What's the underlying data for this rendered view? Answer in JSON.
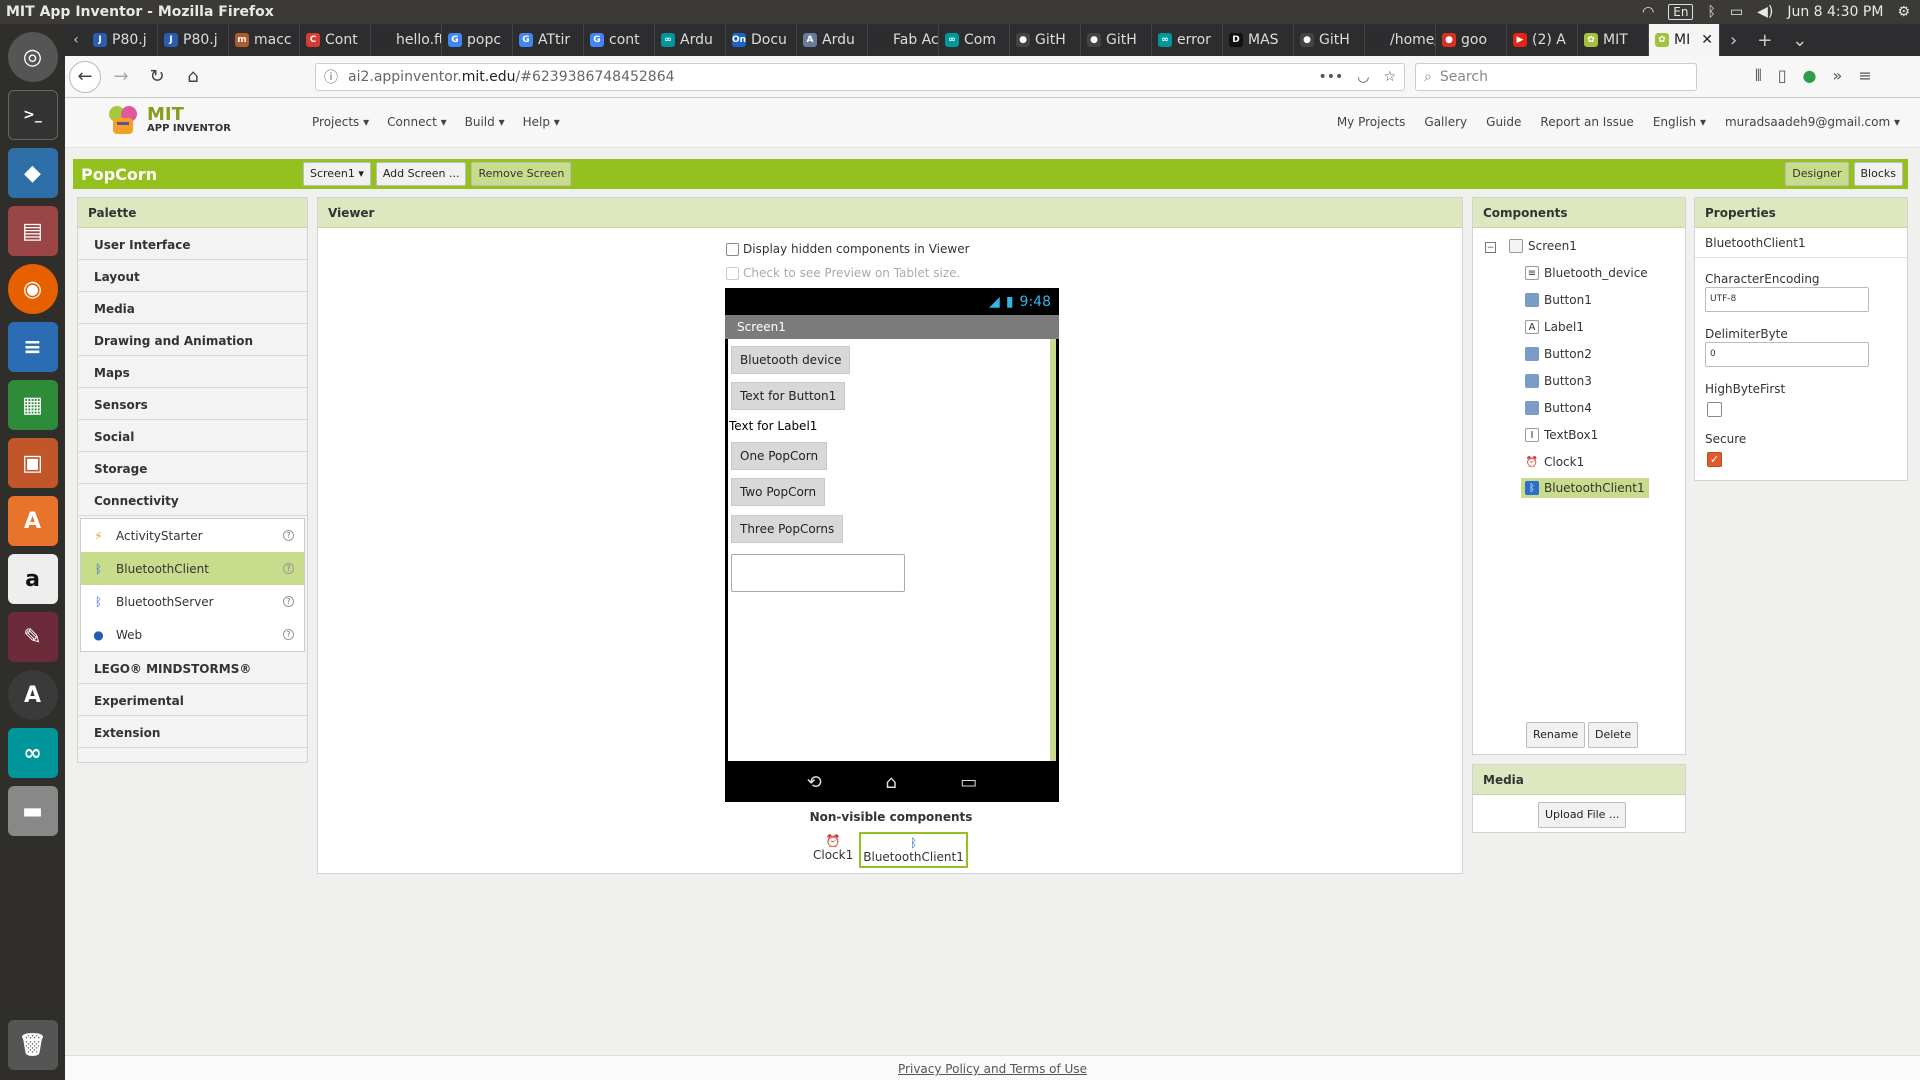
{
  "os": {
    "window_title": "MIT App Inventor - Mozilla Firefox",
    "keyboard_layout": "En",
    "clock": "Jun 8  4:30 PM"
  },
  "browser": {
    "tabs": [
      {
        "label": "P80.j",
        "icon_color": "#2a5db0",
        "icon_text": "J"
      },
      {
        "label": "P80.j",
        "icon_color": "#2a5db0",
        "icon_text": "J"
      },
      {
        "label": "macc",
        "icon_color": "#b35a2b",
        "icon_text": "m"
      },
      {
        "label": "Cont",
        "icon_color": "#d83b2f",
        "icon_text": "C"
      },
      {
        "label": "hello.ft",
        "icon_color": "#2d2d2f",
        "icon_text": ""
      },
      {
        "label": "popc",
        "icon_color": "#4285f4",
        "icon_text": "G"
      },
      {
        "label": "ATtir",
        "icon_color": "#4285f4",
        "icon_text": "G"
      },
      {
        "label": "cont",
        "icon_color": "#4285f4",
        "icon_text": "G"
      },
      {
        "label": "Ardu",
        "icon_color": "#00979c",
        "icon_text": "∞"
      },
      {
        "label": "Docu",
        "icon_color": "#1c63c7",
        "icon_text": "On"
      },
      {
        "label": "Ardu",
        "icon_color": "#6a7b9a",
        "icon_text": "A"
      },
      {
        "label": "Fab Aca",
        "icon_color": "#2d2d2f",
        "icon_text": ""
      },
      {
        "label": "Com",
        "icon_color": "#00979c",
        "icon_text": "∞"
      },
      {
        "label": "GitH",
        "icon_color": "#444444",
        "icon_text": "●"
      },
      {
        "label": "GitH",
        "icon_color": "#444444",
        "icon_text": "●"
      },
      {
        "label": "error",
        "icon_color": "#00979c",
        "icon_text": "∞"
      },
      {
        "label": "MAS",
        "icon_color": "#111111",
        "icon_text": "D"
      },
      {
        "label": "GitH",
        "icon_color": "#444444",
        "icon_text": "●"
      },
      {
        "label": "/home/r",
        "icon_color": "#2d2d2f",
        "icon_text": ""
      },
      {
        "label": "goo",
        "icon_color": "#d93025",
        "icon_text": "●"
      },
      {
        "label": "(2) A",
        "icon_color": "#e62117",
        "icon_text": "▶"
      },
      {
        "label": "MIT",
        "icon_color": "#a3c13b",
        "icon_text": "✿"
      },
      {
        "label": "MI",
        "icon_color": "#a3c13b",
        "icon_text": "✿",
        "active": true
      }
    ],
    "url_prefix": "ai2.appinventor.",
    "url_domain": "mit.edu",
    "url_suffix": "/#6239386748452864",
    "search_placeholder": "Search"
  },
  "app_header": {
    "logo_mit": "MIT",
    "logo_sub": "APP INVENTOR",
    "menu": [
      "Projects ▾",
      "Connect ▾",
      "Build ▾",
      "Help ▾"
    ],
    "right_links": [
      "My Projects",
      "Gallery",
      "Guide",
      "Report an Issue",
      "English ▾",
      "muradsaadeh9@gmail.com ▾"
    ]
  },
  "project_bar": {
    "name": "PopCorn",
    "screen_select": "Screen1 ▾",
    "add_screen": "Add Screen ...",
    "remove_screen": "Remove Screen",
    "designer": "Designer",
    "blocks": "Blocks"
  },
  "palette": {
    "title": "Palette",
    "categories_top": [
      "User Interface",
      "Layout",
      "Media",
      "Drawing and Animation",
      "Maps",
      "Sensors",
      "Social",
      "Storage",
      "Connectivity"
    ],
    "connectivity_items": [
      {
        "label": "ActivityStarter",
        "icon": "lightning-icon"
      },
      {
        "label": "BluetoothClient",
        "icon": "bluetooth-icon",
        "selected": true
      },
      {
        "label": "BluetoothServer",
        "icon": "bluetooth-icon"
      },
      {
        "label": "Web",
        "icon": "globe-icon"
      }
    ],
    "categories_bottom": [
      "LEGO® MINDSTORMS®",
      "Experimental",
      "Extension"
    ],
    "help_glyph": "?"
  },
  "viewer": {
    "title": "Viewer",
    "hidden_checkbox_label": "Display hidden components in Viewer",
    "tablet_checkbox_label": "Check to see Preview on Tablet size.",
    "phone_time": "9:48",
    "screen_title": "Screen1",
    "button_bluetooth": "Bluetooth device",
    "button1": "Text for Button1",
    "label1": "Text for Label1",
    "button_one": "One PopCorn",
    "button_two": "Two PopCorn",
    "button_three": "Three PopCorns",
    "nonvisible_title": "Non-visible components",
    "nonvisible_items": [
      "Clock1",
      "BluetoothClient1"
    ]
  },
  "components": {
    "title": "Components",
    "tree": [
      {
        "label": "Screen1",
        "icon": "screen-icon"
      },
      {
        "label": "Bluetooth_device",
        "icon": "listpicker-icon"
      },
      {
        "label": "Button1",
        "icon": "button-icon"
      },
      {
        "label": "Label1",
        "icon": "label-icon"
      },
      {
        "label": "Button2",
        "icon": "button-icon"
      },
      {
        "label": "Button3",
        "icon": "button-icon"
      },
      {
        "label": "Button4",
        "icon": "button-icon"
      },
      {
        "label": "TextBox1",
        "icon": "textbox-icon"
      },
      {
        "label": "Clock1",
        "icon": "clock-icon"
      },
      {
        "label": "BluetoothClient1",
        "icon": "bluetooth-icon",
        "selected": true
      }
    ],
    "rename": "Rename",
    "delete": "Delete"
  },
  "media": {
    "title": "Media",
    "upload": "Upload File ..."
  },
  "properties": {
    "title": "Properties",
    "component": "BluetoothClient1",
    "character_encoding_label": "CharacterEncoding",
    "character_encoding_value": "UTF-8",
    "delimiter_label": "DelimiterByte",
    "delimiter_value": "0",
    "highbyte_label": "HighByteFirst",
    "highbyte_checked": false,
    "secure_label": "Secure",
    "secure_checked": true
  },
  "footer": {
    "link": "Privacy Policy and Terms of Use"
  },
  "colors": {
    "accent_green": "#95c11f",
    "panel_header": "#dde8c0",
    "selection": "#c9dc8c"
  }
}
